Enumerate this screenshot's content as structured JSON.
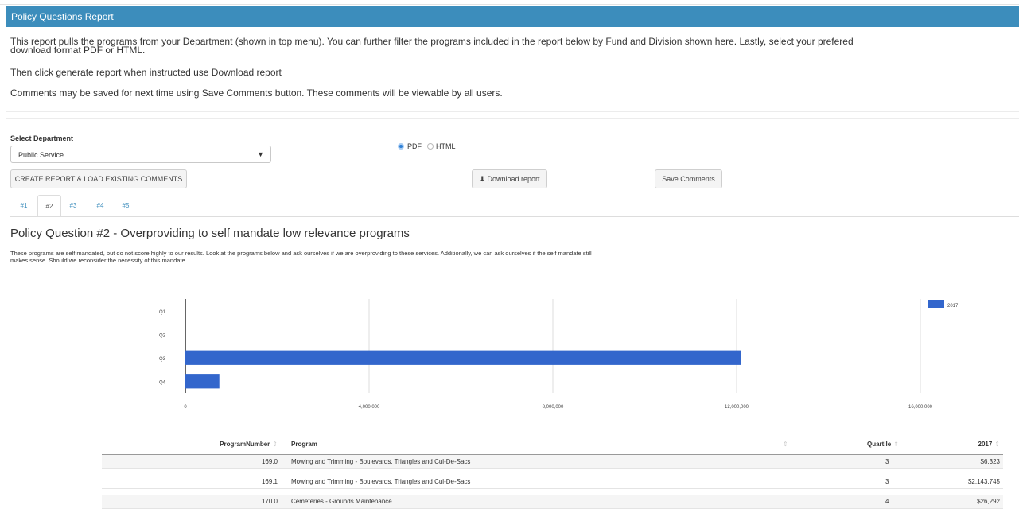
{
  "header": {
    "title": "Policy Questions Report"
  },
  "intro": {
    "line1a": "This report pulls the programs from your Department (shown in top menu). You can further filter the programs included in the report below by Fund and Division shown here. Lastly, select your prefered",
    "line1b": "download format PDF or HTML.",
    "line2": "Then click generate report when instructed use Download report",
    "line3": "Comments may be saved for next time using Save Comments button. These comments will be viewable by all users."
  },
  "department": {
    "label": "Select Department",
    "value": "Public Service"
  },
  "format": {
    "pdf": "PDF",
    "html": "HTML",
    "selected": "PDF"
  },
  "buttons": {
    "create": "CREATE REPORT & LOAD EXISTING COMMENTS",
    "download": "Download report",
    "download_icon": "download-icon",
    "save": "Save Comments"
  },
  "tabs": [
    "#1",
    "#2",
    "#3",
    "#4",
    "#5"
  ],
  "active_tab": 1,
  "question": {
    "title": "Policy Question #2 - Overproviding to self mandate low relevance programs",
    "desc1": "These programs are self mandated, but do not score highly to our results. Look at the programs below and ask ourselves if we are overproviding to these services. Additionally, we can ask ourselves if the self mandate still",
    "desc2": "makes sense. Should we reconsider the necessity of this mandate."
  },
  "chart_data": {
    "type": "bar",
    "orientation": "horizontal",
    "categories": [
      "Q1",
      "Q2",
      "Q3",
      "Q4"
    ],
    "series": [
      {
        "name": "2017",
        "values": [
          0,
          0,
          12100000,
          740000
        ],
        "color": "#3366cc"
      }
    ],
    "xlim": [
      0,
      16000000
    ],
    "xticks": [
      "0",
      "4,000,000",
      "8,000,000",
      "12,000,000",
      "16,000,000"
    ],
    "xtick_values": [
      0,
      4000000,
      8000000,
      12000000,
      16000000
    ],
    "grid": true,
    "legend": "top-right"
  },
  "table": {
    "columns": [
      "ProgramNumber",
      "Program",
      "Quartile",
      "2017"
    ],
    "rows": [
      [
        "169.0",
        "Mowing and Trimming - Boulevards, Triangles and Cul-De-Sacs",
        "3",
        "$6,323"
      ],
      [
        "169.1",
        "Mowing and Trimming - Boulevards, Triangles and Cul-De-Sacs",
        "3",
        "$2,143,745"
      ],
      [
        "170.0",
        "Cemeteries - Grounds Maintenance",
        "4",
        "$26,292"
      ]
    ]
  }
}
